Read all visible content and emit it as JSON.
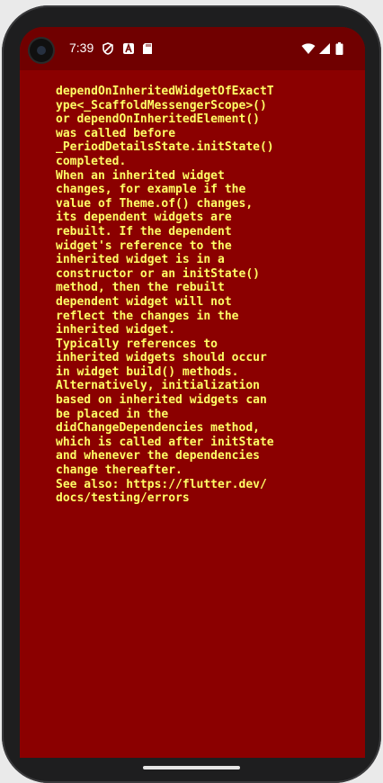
{
  "status_bar": {
    "time": "7:39",
    "left_icons": [
      "privacy-shield-icon",
      "a-badge-icon",
      "sd-card-icon"
    ],
    "right_icons": [
      "wifi-icon",
      "cell-signal-icon",
      "battery-icon"
    ]
  },
  "error": {
    "text": "dependOnInheritedWidgetOfExactT\nype<_ScaffoldMessengerScope>()\nor dependOnInheritedElement()\nwas called before\n_PeriodDetailsState.initState()\ncompleted.\nWhen an inherited widget\nchanges, for example if the\nvalue of Theme.of() changes,\nits dependent widgets are\nrebuilt. If the dependent\nwidget's reference to the\ninherited widget is in a\nconstructor or an initState()\nmethod, then the rebuilt\ndependent widget will not\nreflect the changes in the\ninherited widget.\nTypically references to\ninherited widgets should occur\nin widget build() methods.\nAlternatively, initialization\nbased on inherited widgets can\nbe placed in the\ndidChangeDependencies method,\nwhich is called after initState\nand whenever the dependencies\nchange thereafter.\nSee also: https://flutter.dev/\ndocs/testing/errors"
  },
  "colors": {
    "screen_background": "#8b0000",
    "status_bar_background": "#700000",
    "error_text": "#ffff66"
  }
}
